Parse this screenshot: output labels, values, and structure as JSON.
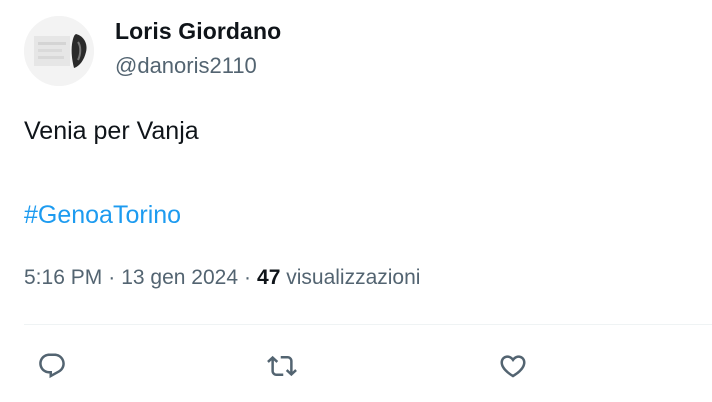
{
  "author": {
    "display_name": "Loris Giordano",
    "handle": "@danoris2110"
  },
  "tweet": {
    "text": "Venia per Vanja",
    "hashtag": "#GenoaTorino",
    "time": "5:16 PM",
    "date": "13 gen 2024",
    "separator": "·",
    "view_count": "47",
    "view_label": "visualizzazioni"
  },
  "actions": [
    {
      "icon": "reply-icon"
    },
    {
      "icon": "retweet-icon"
    },
    {
      "icon": "like-icon"
    }
  ],
  "colors": {
    "text": "#0f1419",
    "secondary": "#536471",
    "link": "#1d9bf0",
    "divider": "#eff3f4"
  }
}
